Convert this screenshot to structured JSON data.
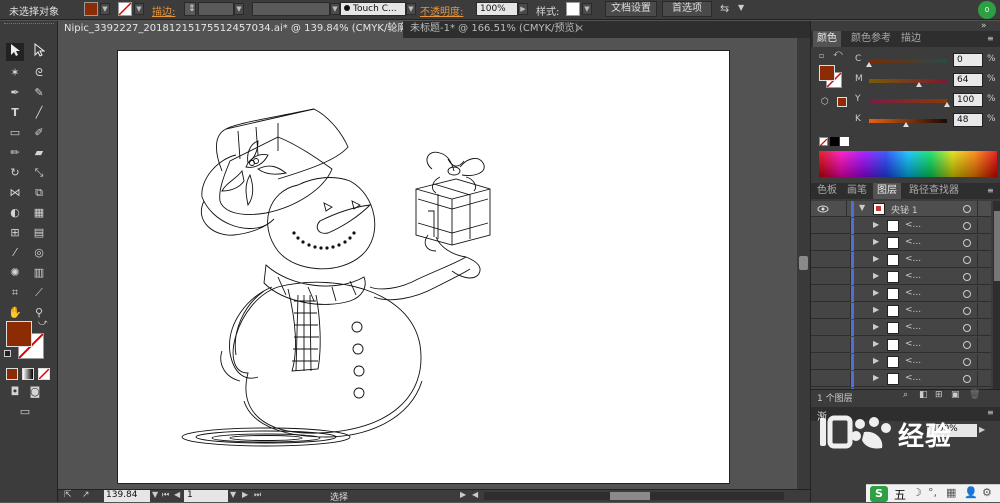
{
  "control_bar": {
    "selection_status": "未选择对象",
    "stroke_label": "描边:",
    "brush_label": "Touch C...",
    "opacity_label": "不透明度:",
    "opacity_value": "100%",
    "style_label": "样式:",
    "doc_setup_button": "文档设置",
    "preferences_button": "首选项",
    "fill_color": "#8b2c05"
  },
  "tabs": [
    {
      "label": "Nipic_3392227_20181215175512457034.ai* @ 139.84% (CMYK/轮廓)",
      "close": "×"
    },
    {
      "label": "未标题-1* @ 166.51% (CMYK/预览)",
      "close": "×"
    }
  ],
  "status_bar": {
    "zoom": "139.84",
    "artboard_number": "1",
    "current_tool": "选择"
  },
  "color_panel": {
    "tabs": [
      "颜色",
      "颜色参考",
      "描边"
    ],
    "channels": [
      {
        "label": "C",
        "value": "0",
        "fraction": 0.0
      },
      {
        "label": "M",
        "value": "64",
        "fraction": 0.64
      },
      {
        "label": "Y",
        "value": "100",
        "fraction": 1.0
      },
      {
        "label": "K",
        "value": "48",
        "fraction": 0.48
      }
    ],
    "unit": "%"
  },
  "layers_panel": {
    "tabs": [
      "色板",
      "画笔",
      "图层",
      "路径查找器"
    ],
    "top_layer": "央铋 1",
    "sublayers": [
      "<...",
      "<...",
      "<...",
      "<...",
      "<...",
      "<...",
      "<...",
      "<...",
      "<...",
      "<...",
      "<..."
    ],
    "footer_count": "1 个图层"
  },
  "lower_panel": {
    "title": "渐",
    "opacity_value": "100%"
  },
  "watermark": {
    "text": "经验"
  },
  "taskbar": {
    "ime": "五"
  }
}
